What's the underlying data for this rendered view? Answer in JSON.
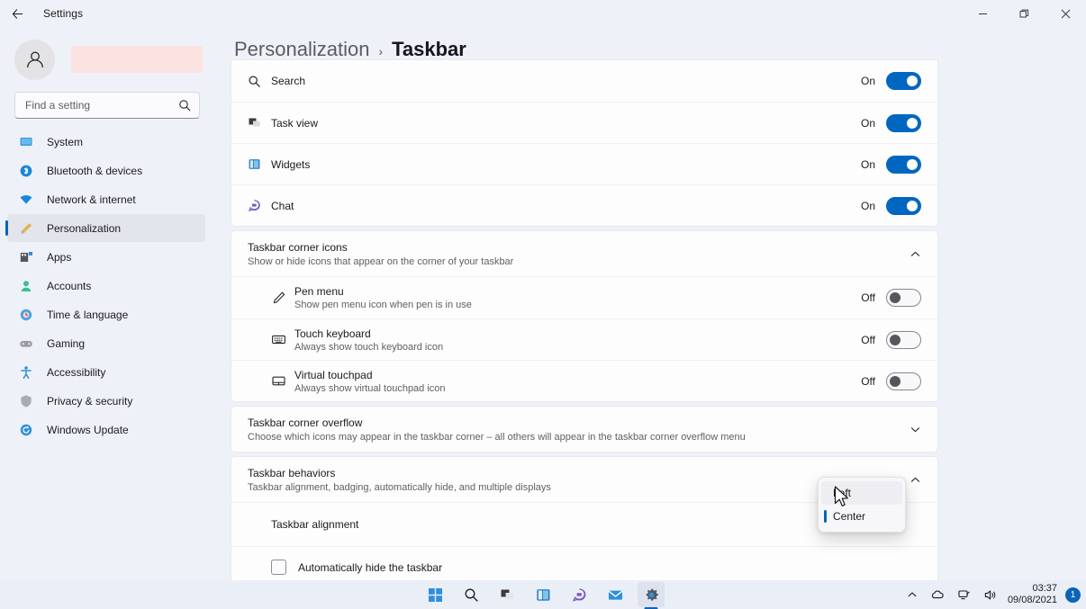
{
  "window": {
    "title": "Settings",
    "back_icon": "back-arrow-icon",
    "minimize_label": "Minimize",
    "restore_label": "Restore",
    "close_label": "Close"
  },
  "sidebar": {
    "account_name_redacted": "",
    "search": {
      "placeholder": "Find a setting",
      "value": ""
    },
    "items": [
      {
        "label": "System",
        "icon": "monitor-icon",
        "selected": false
      },
      {
        "label": "Bluetooth & devices",
        "icon": "bluetooth-icon",
        "selected": false
      },
      {
        "label": "Network & internet",
        "icon": "wifi-icon",
        "selected": false
      },
      {
        "label": "Personalization",
        "icon": "paintbrush-icon",
        "selected": true
      },
      {
        "label": "Apps",
        "icon": "apps-icon",
        "selected": false
      },
      {
        "label": "Accounts",
        "icon": "person-icon",
        "selected": false
      },
      {
        "label": "Time & language",
        "icon": "clock-globe-icon",
        "selected": false
      },
      {
        "label": "Gaming",
        "icon": "gamepad-icon",
        "selected": false
      },
      {
        "label": "Accessibility",
        "icon": "accessibility-icon",
        "selected": false
      },
      {
        "label": "Privacy & security",
        "icon": "shield-icon",
        "selected": false
      },
      {
        "label": "Windows Update",
        "icon": "update-icon",
        "selected": false
      }
    ]
  },
  "breadcrumb": {
    "parent": "Personalization",
    "separator": "›",
    "current": "Taskbar"
  },
  "taskbar_items": [
    {
      "label": "Search",
      "icon": "search-icon",
      "state": "On",
      "on": true
    },
    {
      "label": "Task view",
      "icon": "task-view-icon",
      "state": "On",
      "on": true
    },
    {
      "label": "Widgets",
      "icon": "widgets-icon",
      "state": "On",
      "on": true
    },
    {
      "label": "Chat",
      "icon": "chat-icon",
      "state": "On",
      "on": true
    }
  ],
  "corner_icons": {
    "title": "Taskbar corner icons",
    "subtitle": "Show or hide icons that appear on the corner of your taskbar",
    "expanded": true,
    "chevron": "chevron-up-icon",
    "rows": [
      {
        "title": "Pen menu",
        "subtitle": "Show pen menu icon when pen is in use",
        "icon": "pen-icon",
        "state": "Off",
        "on": false
      },
      {
        "title": "Touch keyboard",
        "subtitle": "Always show touch keyboard icon",
        "icon": "keyboard-icon",
        "state": "Off",
        "on": false
      },
      {
        "title": "Virtual touchpad",
        "subtitle": "Always show virtual touchpad icon",
        "icon": "touchpad-icon",
        "state": "Off",
        "on": false
      }
    ]
  },
  "corner_overflow": {
    "title": "Taskbar corner overflow",
    "subtitle": "Choose which icons may appear in the taskbar corner – all others will appear in the taskbar corner overflow menu",
    "expanded": false,
    "chevron": "chevron-down-icon"
  },
  "behaviors": {
    "title": "Taskbar behaviors",
    "subtitle": "Taskbar alignment, badging, automatically hide, and multiple displays",
    "expanded": true,
    "chevron": "chevron-up-icon",
    "alignment_label": "Taskbar alignment",
    "autohide_label": "Automatically hide the taskbar",
    "autohide_checked": false
  },
  "dropdown": {
    "open": true,
    "options": [
      "Left",
      "Center"
    ],
    "hovered": "Left",
    "selected": "Center"
  },
  "system_taskbar": {
    "apps": [
      {
        "name": "start-button",
        "label": "Start",
        "active": false
      },
      {
        "name": "search-button",
        "label": "Search",
        "active": false
      },
      {
        "name": "task-view-button",
        "label": "Task view",
        "active": false
      },
      {
        "name": "widgets-button",
        "label": "Widgets",
        "active": false
      },
      {
        "name": "chat-button",
        "label": "Chat",
        "active": false
      },
      {
        "name": "mail-button",
        "label": "Mail",
        "active": false
      },
      {
        "name": "settings-button",
        "label": "Settings",
        "active": true
      }
    ],
    "tray": {
      "overflow_icon": "chevron-up-icon",
      "onedrive_icon": "cloud-icon",
      "network_icon": "network-icon",
      "volume_icon": "speaker-icon",
      "time": "03:37",
      "date": "09/08/2021",
      "notification_count": "1"
    }
  },
  "colors": {
    "accent": "#0067c0",
    "indicator": "#0a64b8",
    "page_bg": "#eef1f8",
    "card_bg": "#fdfdfd"
  }
}
